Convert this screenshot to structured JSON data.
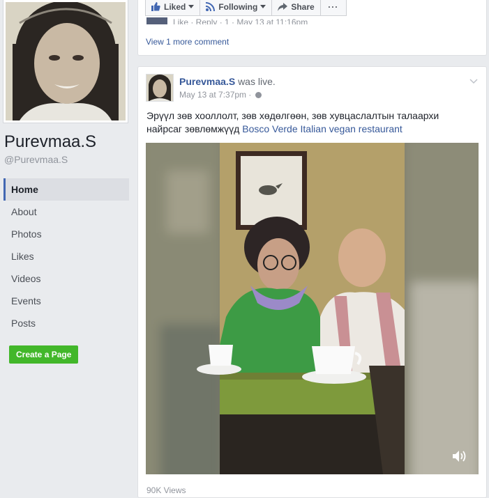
{
  "page": {
    "name": "Purevmaa.S",
    "handle": "@Purevmaa.S"
  },
  "nav": {
    "items": [
      {
        "label": "Home",
        "active": true
      },
      {
        "label": "About"
      },
      {
        "label": "Photos"
      },
      {
        "label": "Likes"
      },
      {
        "label": "Videos"
      },
      {
        "label": "Events"
      },
      {
        "label": "Posts"
      }
    ],
    "create_page": "Create a Page"
  },
  "actions": {
    "liked": "Liked",
    "following": "Following",
    "share": "Share",
    "more": "···"
  },
  "previous_post": {
    "comment_meta": "Like · Reply · 1 · May 13 at 11:16pm",
    "view_more": "View 1 more comment"
  },
  "post": {
    "author": "Purevmaa.S",
    "activity": "was live.",
    "time": "May 13 at 7:37pm",
    "separator": "·",
    "text": "Эрүүл зөв хооллолт, зөв хөдөлгөөн, зөв хувцаслалтын талаархи найрсаг зөвлөмжүүд ",
    "text_link": "Bosco Verde Italian vegan restaurant",
    "views": "90K Views"
  },
  "icons": {
    "like": "thumbs-up-icon",
    "following": "rss-icon",
    "share": "share-arrow-icon",
    "globe": "globe-icon",
    "chevron": "chevron-down-icon",
    "volume": "volume-icon"
  },
  "colors": {
    "link": "#365899",
    "accent": "#4267b2",
    "create_button": "#42b72a"
  }
}
